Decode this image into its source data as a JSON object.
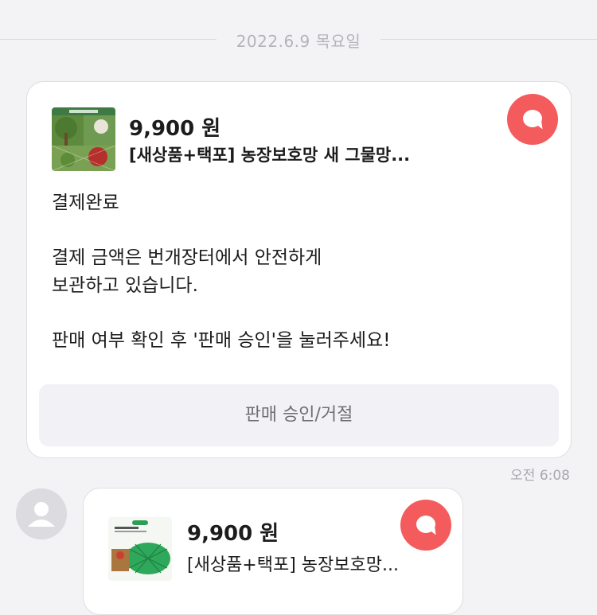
{
  "date_separator": "2022.6.9 목요일",
  "messages": [
    {
      "product": {
        "price": "9,900 원",
        "title": "[새상품+택포] 농장보호망 새 그물망..."
      },
      "body": {
        "line1": "결제완료",
        "line2": "결제 금액은 번개장터에서 안전하게",
        "line3": "보관하고 있습니다.",
        "line4": "판매 여부 확인 후 '판매 승인'을 눌러주세요!"
      },
      "action_label": "판매 승인/거절",
      "time": "오전 6:08"
    },
    {
      "product": {
        "price": "9,900 원",
        "title": "[새상품+택포] 농장보호망..."
      }
    }
  ],
  "colors": {
    "accent": "#f35b5d",
    "background": "#f3f3f6",
    "card": "#ffffff",
    "muted_text": "#a8a8ad"
  },
  "icons": [
    "chat-bubble-icon",
    "user-avatar-icon"
  ]
}
